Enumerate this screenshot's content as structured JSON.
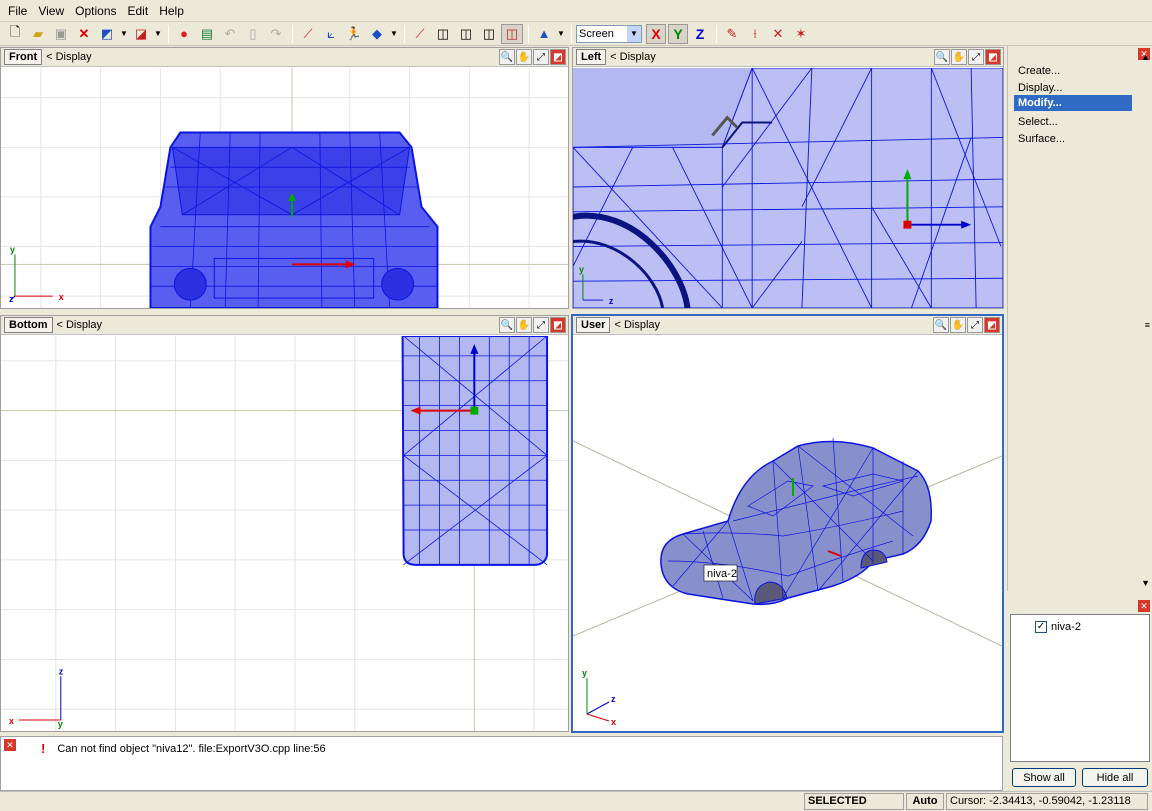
{
  "menu": [
    "File",
    "View",
    "Options",
    "Edit",
    "Help"
  ],
  "toolbar": {
    "view_mode": "Screen",
    "axis_x": "X",
    "axis_y": "Y",
    "axis_z": "Z"
  },
  "viewports": {
    "front": {
      "title": "Front",
      "display": "< Display",
      "axis_a": "y",
      "axis_b": "z",
      "axis_c": "x"
    },
    "left": {
      "title": "Left",
      "display": "< Display",
      "axis_a": "y",
      "axis_b": "z"
    },
    "bottom": {
      "title": "Bottom",
      "display": "< Display",
      "axis_a": "z",
      "axis_b": "x",
      "axis_c": "y"
    },
    "user": {
      "title": "User",
      "display": "< Display",
      "axis_a": "y",
      "axis_b": "z",
      "axis_c": "x",
      "object_label": "niva-2"
    }
  },
  "commands": [
    "Create...",
    "Display...",
    "Modify...",
    "Select...",
    "Surface..."
  ],
  "selected_command": "Modify...",
  "objects": {
    "item": "niva-2",
    "show_all": "Show all",
    "hide_all": "Hide all"
  },
  "log": {
    "message": "Can not find object \"niva12\". file:ExportV3O.cpp line:56"
  },
  "status": {
    "mode": "SELECTED MODE",
    "auto": "Auto",
    "cursor": "Cursor: -2.34413, -0.59042, -1.23118"
  },
  "colors": {
    "mesh": "#0a14e0",
    "fill": "#b4b8f0",
    "accent": "#316ac5"
  }
}
